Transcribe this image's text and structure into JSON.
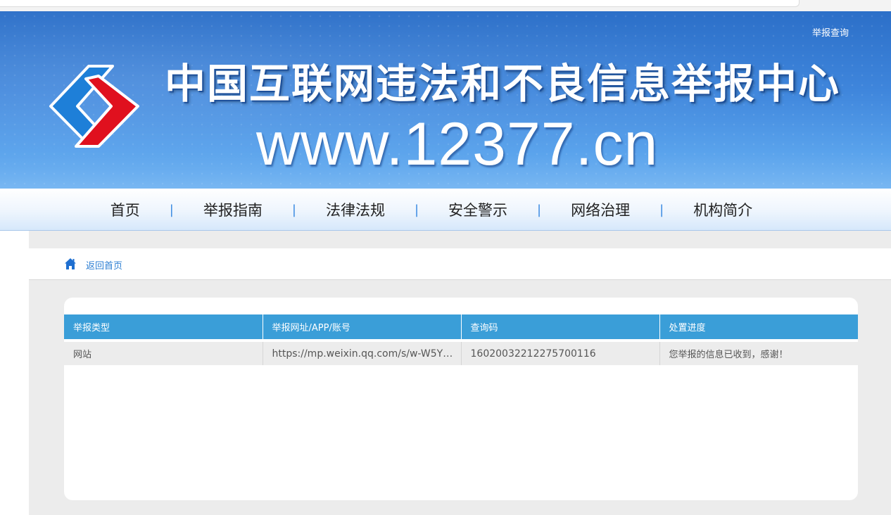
{
  "header": {
    "report_query_link": "举报查询",
    "site_title": "中国互联网违法和不良信息举报中心",
    "site_url": "www.12377.cn",
    "logo_colors": {
      "blue": "#1e7fd8",
      "red": "#e0101e"
    }
  },
  "nav": {
    "items": [
      {
        "label": "首页"
      },
      {
        "label": "举报指南"
      },
      {
        "label": "法律法规"
      },
      {
        "label": "安全警示"
      },
      {
        "label": "网络治理"
      },
      {
        "label": "机构简介"
      }
    ],
    "separator": "|"
  },
  "breadcrumb": {
    "home_label": "返回首页"
  },
  "report_table": {
    "columns": [
      "举报类型",
      "举报网址/APP/账号",
      "查询码",
      "处置进度"
    ],
    "rows": [
      {
        "type": "网站",
        "url": "https://mp.weixin.qq.com/s/w-W5YR...",
        "query_code": "16020032212275700116",
        "status": "您举报的信息已收到，感谢！"
      }
    ]
  },
  "colors": {
    "header_blue": "#3a9ed8",
    "link_blue": "#2d7fd3",
    "banner_blue": "#3f86dc"
  }
}
